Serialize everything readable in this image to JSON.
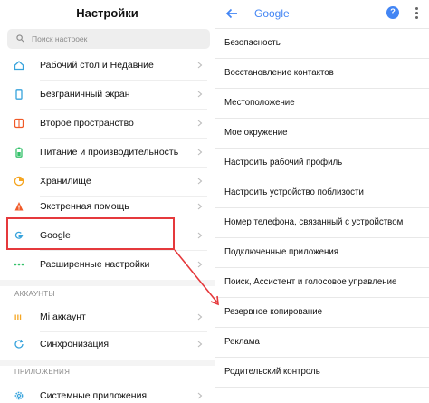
{
  "left": {
    "title": "Настройки",
    "search_placeholder": "Поиск настроек",
    "items_top": [
      {
        "label": "Рабочий стол и Недавние",
        "icon": "home-icon"
      },
      {
        "label": "Безграничный экран",
        "icon": "phone-screen-icon"
      },
      {
        "label": "Второе пространство",
        "icon": "second-space-icon"
      },
      {
        "label": "Питание и производительность",
        "icon": "battery-icon"
      },
      {
        "label": "Хранилище",
        "icon": "storage-icon"
      },
      {
        "label": "Экстренная помощь",
        "icon": "emergency-icon"
      },
      {
        "label": "Google",
        "icon": "google-icon"
      },
      {
        "label": "Расширенные настройки",
        "icon": "more-dots-icon"
      }
    ],
    "section_accounts": "АККАУНТЫ",
    "items_accounts": [
      {
        "label": "Mi аккаунт",
        "icon": "mi-icon"
      },
      {
        "label": "Синхронизация",
        "icon": "sync-icon"
      }
    ],
    "section_apps": "ПРИЛОЖЕНИЯ",
    "items_apps": [
      {
        "label": "Системные приложения",
        "icon": "gear-icon"
      }
    ]
  },
  "right": {
    "title": "Google",
    "help_glyph": "?",
    "items": [
      "Безопасность",
      "Восстановление контактов",
      "Местоположение",
      "Мое окружение",
      "Настроить рабочий профиль",
      "Настроить устройство поблизости",
      "Номер телефона, связанный с устройством",
      "Подключенные приложения",
      "Поиск, Ассистент и голосовое управление",
      "Резервное копирование",
      "Реклама",
      "Родительский контроль"
    ]
  },
  "colors": {
    "highlight": "#e5393c",
    "google_blue": "#4285f4",
    "icon_blue": "#37a3dc",
    "icon_green": "#34c16a",
    "icon_orange": "#f5a623",
    "icon_red": "#f05a28"
  }
}
